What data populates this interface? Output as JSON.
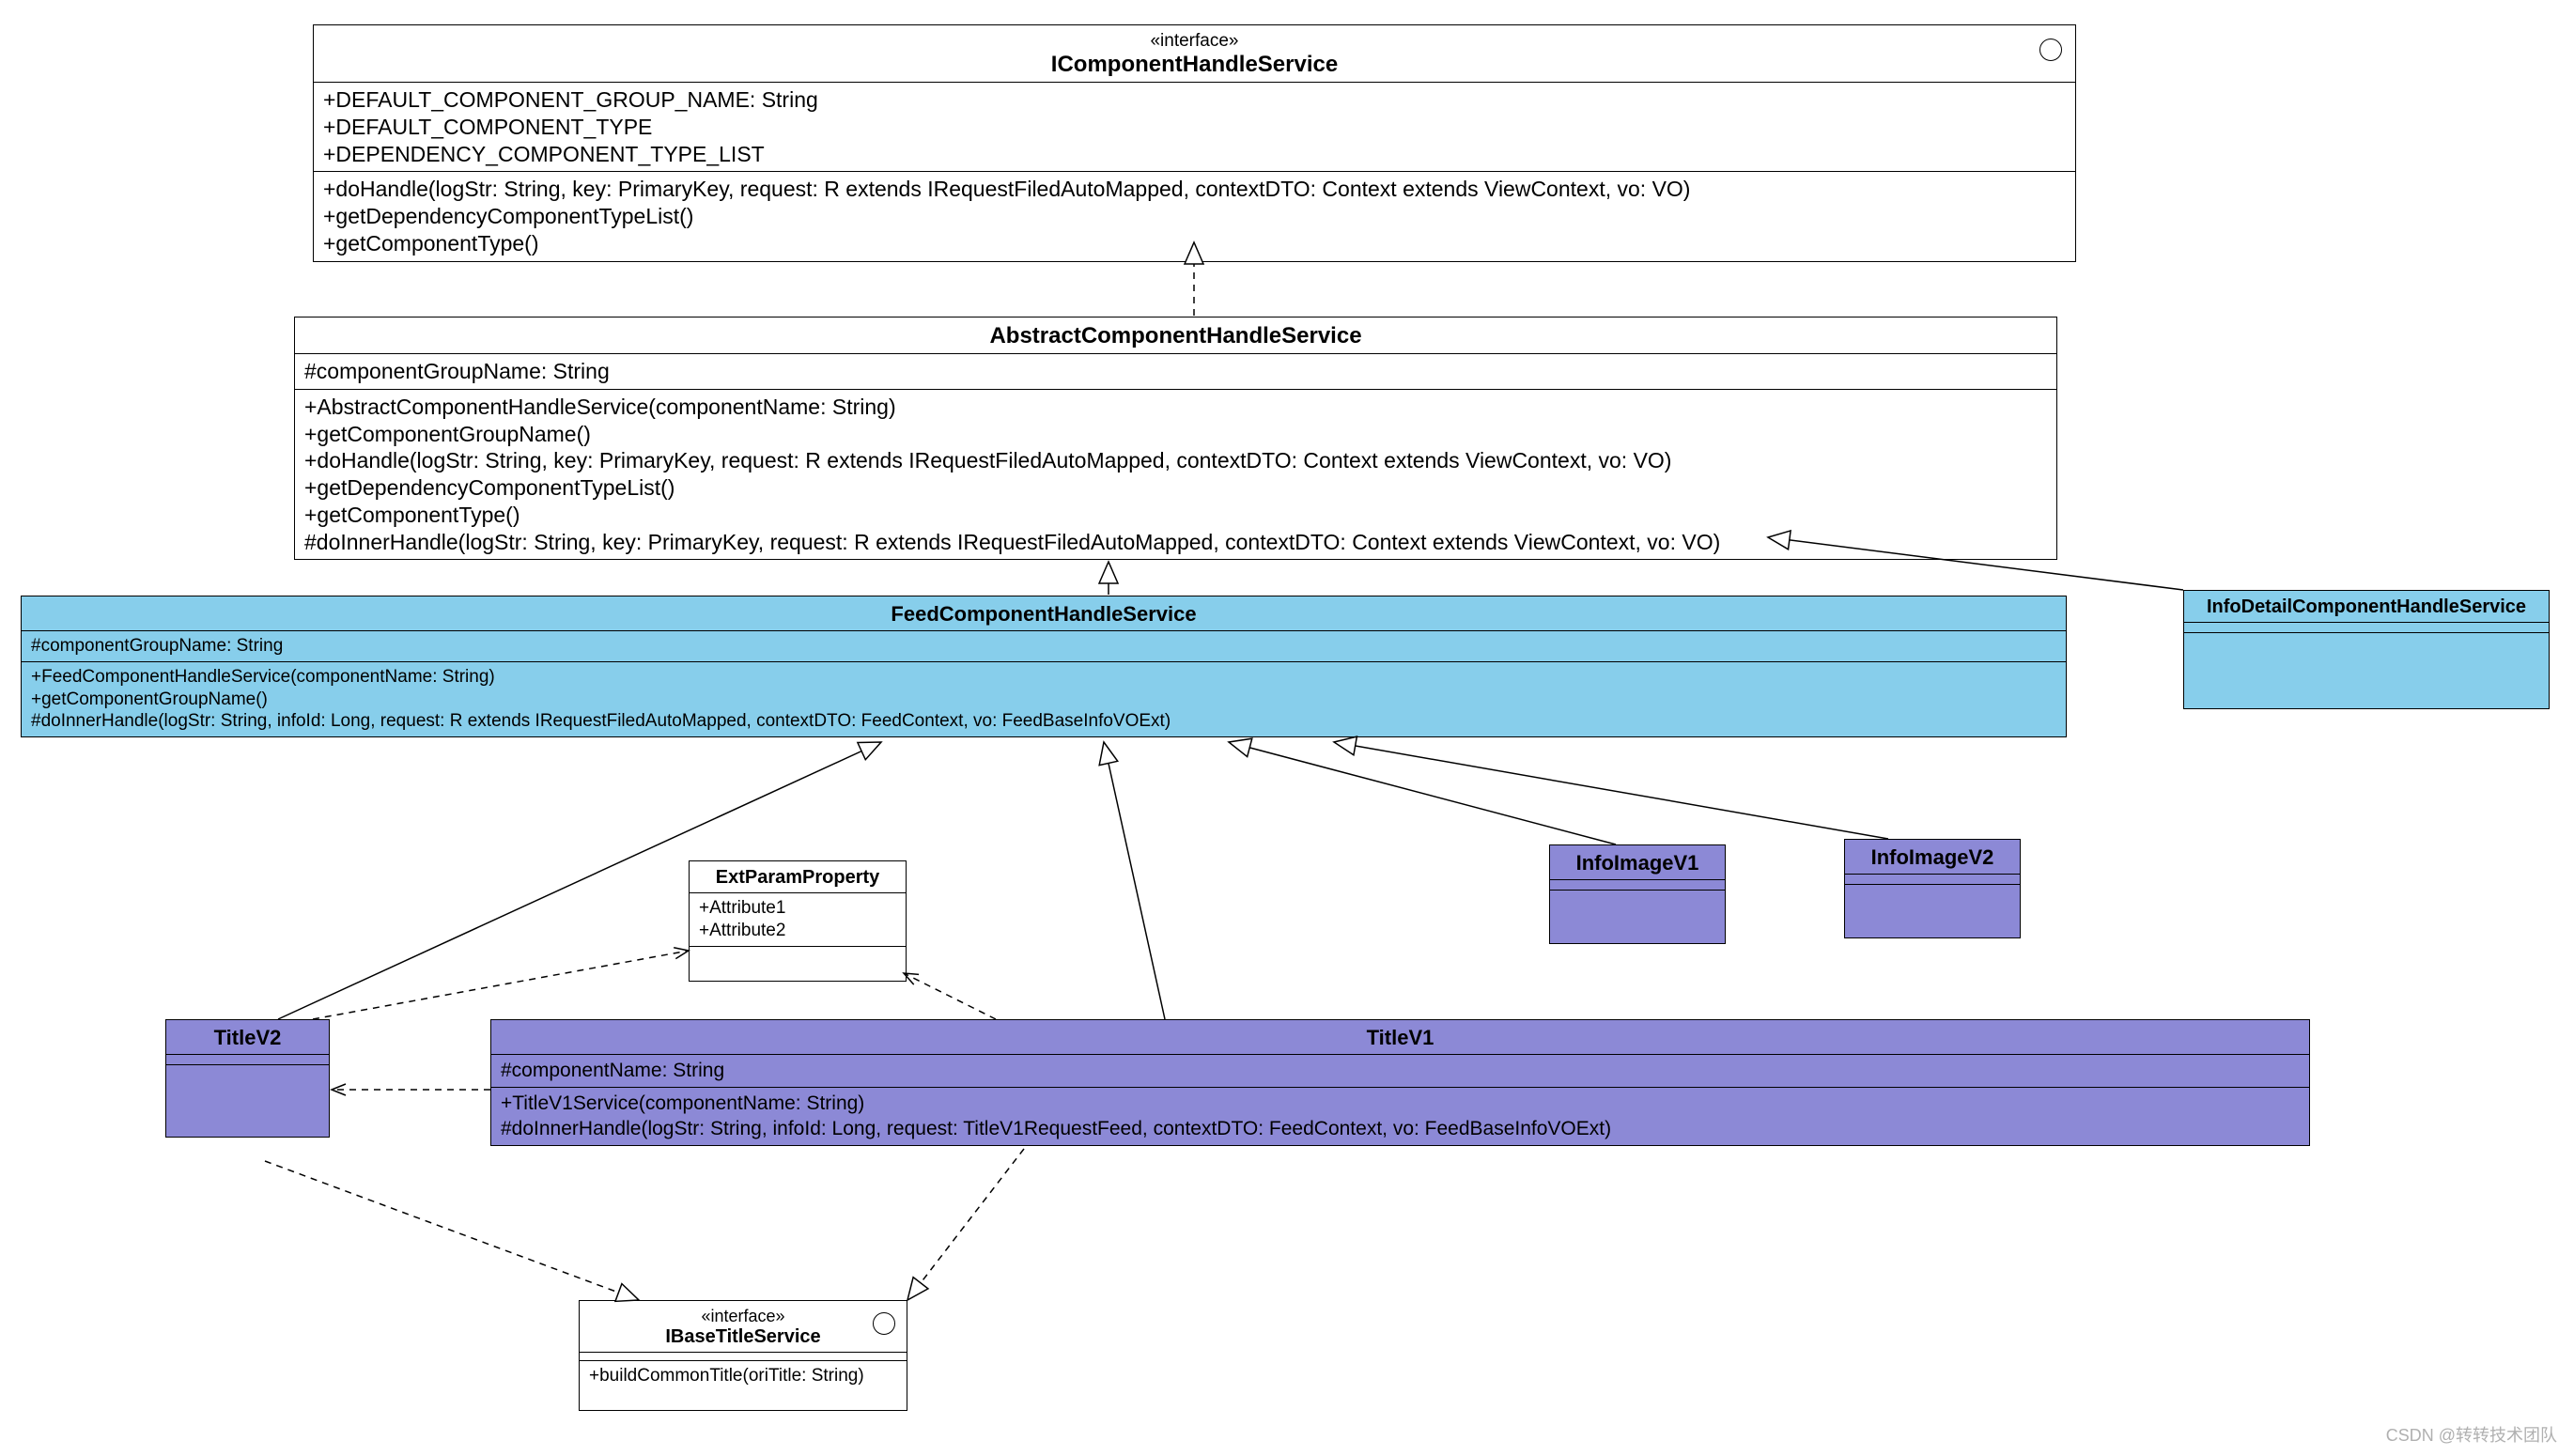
{
  "interface1": {
    "stereo": "«interface»",
    "name": "IComponentHandleService",
    "attrs": [
      "+DEFAULT_COMPONENT_GROUP_NAME: String",
      "+DEFAULT_COMPONENT_TYPE",
      "+DEPENDENCY_COMPONENT_TYPE_LIST"
    ],
    "ops": [
      "+doHandle(logStr: String, key: PrimaryKey, request: R extends IRequestFiledAutoMapped, contextDTO: Context extends ViewContext, vo: VO)",
      "+getDependencyComponentTypeList()",
      "+getComponentType()"
    ]
  },
  "abstract1": {
    "name": "AbstractComponentHandleService",
    "attrs": [
      "#componentGroupName: String"
    ],
    "ops": [
      "+AbstractComponentHandleService(componentName: String)",
      "+getComponentGroupName()",
      "+doHandle(logStr: String, key: PrimaryKey, request: R extends IRequestFiledAutoMapped, contextDTO: Context extends ViewContext, vo: VO)",
      "+getDependencyComponentTypeList()",
      "+getComponentType()",
      "#doInnerHandle(logStr: String, key: PrimaryKey, request: R extends IRequestFiledAutoMapped, contextDTO: Context extends ViewContext, vo: VO)"
    ]
  },
  "feed": {
    "name": "FeedComponentHandleService",
    "attrs": [
      "#componentGroupName: String"
    ],
    "ops": [
      "+FeedComponentHandleService(componentName: String)",
      "+getComponentGroupName()",
      "#doInnerHandle(logStr: String, infoId: Long, request: R extends IRequestFiledAutoMapped, contextDTO: FeedContext, vo: FeedBaseInfoVOExt)"
    ]
  },
  "infoDetail": {
    "name": "InfoDetailComponentHandleService"
  },
  "extParam": {
    "name": "ExtParamProperty",
    "attrs": [
      "+Attribute1",
      "+Attribute2"
    ]
  },
  "infoImageV1": {
    "name": "InfoImageV1"
  },
  "infoImageV2": {
    "name": "InfoImageV2"
  },
  "titleV2": {
    "name": "TitleV2"
  },
  "titleV1": {
    "name": "TitleV1",
    "attrs": [
      "#componentName: String"
    ],
    "ops": [
      "+TitleV1Service(componentName: String)",
      "#doInnerHandle(logStr: String, infoId: Long, request: TitleV1RequestFeed, contextDTO: FeedContext, vo: FeedBaseInfoVOExt)"
    ]
  },
  "interface2": {
    "stereo": "«interface»",
    "name": "IBaseTitleService",
    "ops": [
      "+buildCommonTitle(oriTitle: String)"
    ]
  },
  "watermark": "CSDN @转转技术团队",
  "chart_data": {
    "type": "uml-class-diagram",
    "classes": [
      {
        "id": "IComponentHandleService",
        "stereotype": "interface",
        "attributes": [
          "+DEFAULT_COMPONENT_GROUP_NAME: String",
          "+DEFAULT_COMPONENT_TYPE",
          "+DEPENDENCY_COMPONENT_TYPE_LIST"
        ],
        "operations": [
          "+doHandle(logStr: String, key: PrimaryKey, request: R extends IRequestFiledAutoMapped, contextDTO: Context extends ViewContext, vo: VO)",
          "+getDependencyComponentTypeList()",
          "+getComponentType()"
        ]
      },
      {
        "id": "AbstractComponentHandleService",
        "attributes": [
          "#componentGroupName: String"
        ],
        "operations": [
          "+AbstractComponentHandleService(componentName: String)",
          "+getComponentGroupName()",
          "+doHandle(logStr: String, key: PrimaryKey, request: R extends IRequestFiledAutoMapped, contextDTO: Context extends ViewContext, vo: VO)",
          "+getDependencyComponentTypeList()",
          "+getComponentType()",
          "#doInnerHandle(logStr: String, key: PrimaryKey, request: R extends IRequestFiledAutoMapped, contextDTO: Context extends ViewContext, vo: VO)"
        ]
      },
      {
        "id": "FeedComponentHandleService",
        "attributes": [
          "#componentGroupName: String"
        ],
        "operations": [
          "+FeedComponentHandleService(componentName: String)",
          "+getComponentGroupName()",
          "#doInnerHandle(logStr: String, infoId: Long, request: R extends IRequestFiledAutoMapped, contextDTO: FeedContext, vo: FeedBaseInfoVOExt)"
        ]
      },
      {
        "id": "InfoDetailComponentHandleService"
      },
      {
        "id": "ExtParamProperty",
        "attributes": [
          "+Attribute1",
          "+Attribute2"
        ]
      },
      {
        "id": "InfoImageV1"
      },
      {
        "id": "InfoImageV2"
      },
      {
        "id": "TitleV2"
      },
      {
        "id": "TitleV1",
        "attributes": [
          "#componentName: String"
        ],
        "operations": [
          "+TitleV1Service(componentName: String)",
          "#doInnerHandle(logStr: String, infoId: Long, request: TitleV1RequestFeed, contextDTO: FeedContext, vo: FeedBaseInfoVOExt)"
        ]
      },
      {
        "id": "IBaseTitleService",
        "stereotype": "interface",
        "operations": [
          "+buildCommonTitle(oriTitle: String)"
        ]
      }
    ],
    "relationships": [
      {
        "from": "AbstractComponentHandleService",
        "to": "IComponentHandleService",
        "type": "realization"
      },
      {
        "from": "FeedComponentHandleService",
        "to": "AbstractComponentHandleService",
        "type": "generalization"
      },
      {
        "from": "InfoDetailComponentHandleService",
        "to": "AbstractComponentHandleService",
        "type": "generalization"
      },
      {
        "from": "TitleV2",
        "to": "FeedComponentHandleService",
        "type": "generalization"
      },
      {
        "from": "TitleV1",
        "to": "FeedComponentHandleService",
        "type": "generalization"
      },
      {
        "from": "InfoImageV1",
        "to": "FeedComponentHandleService",
        "type": "generalization"
      },
      {
        "from": "InfoImageV2",
        "to": "FeedComponentHandleService",
        "type": "generalization"
      },
      {
        "from": "TitleV2",
        "to": "IBaseTitleService",
        "type": "realization"
      },
      {
        "from": "TitleV1",
        "to": "IBaseTitleService",
        "type": "realization"
      },
      {
        "from": "TitleV2",
        "to": "ExtParamProperty",
        "type": "dependency"
      },
      {
        "from": "TitleV1",
        "to": "ExtParamProperty",
        "type": "dependency"
      },
      {
        "from": "TitleV1",
        "to": "TitleV2",
        "type": "dependency"
      }
    ]
  }
}
